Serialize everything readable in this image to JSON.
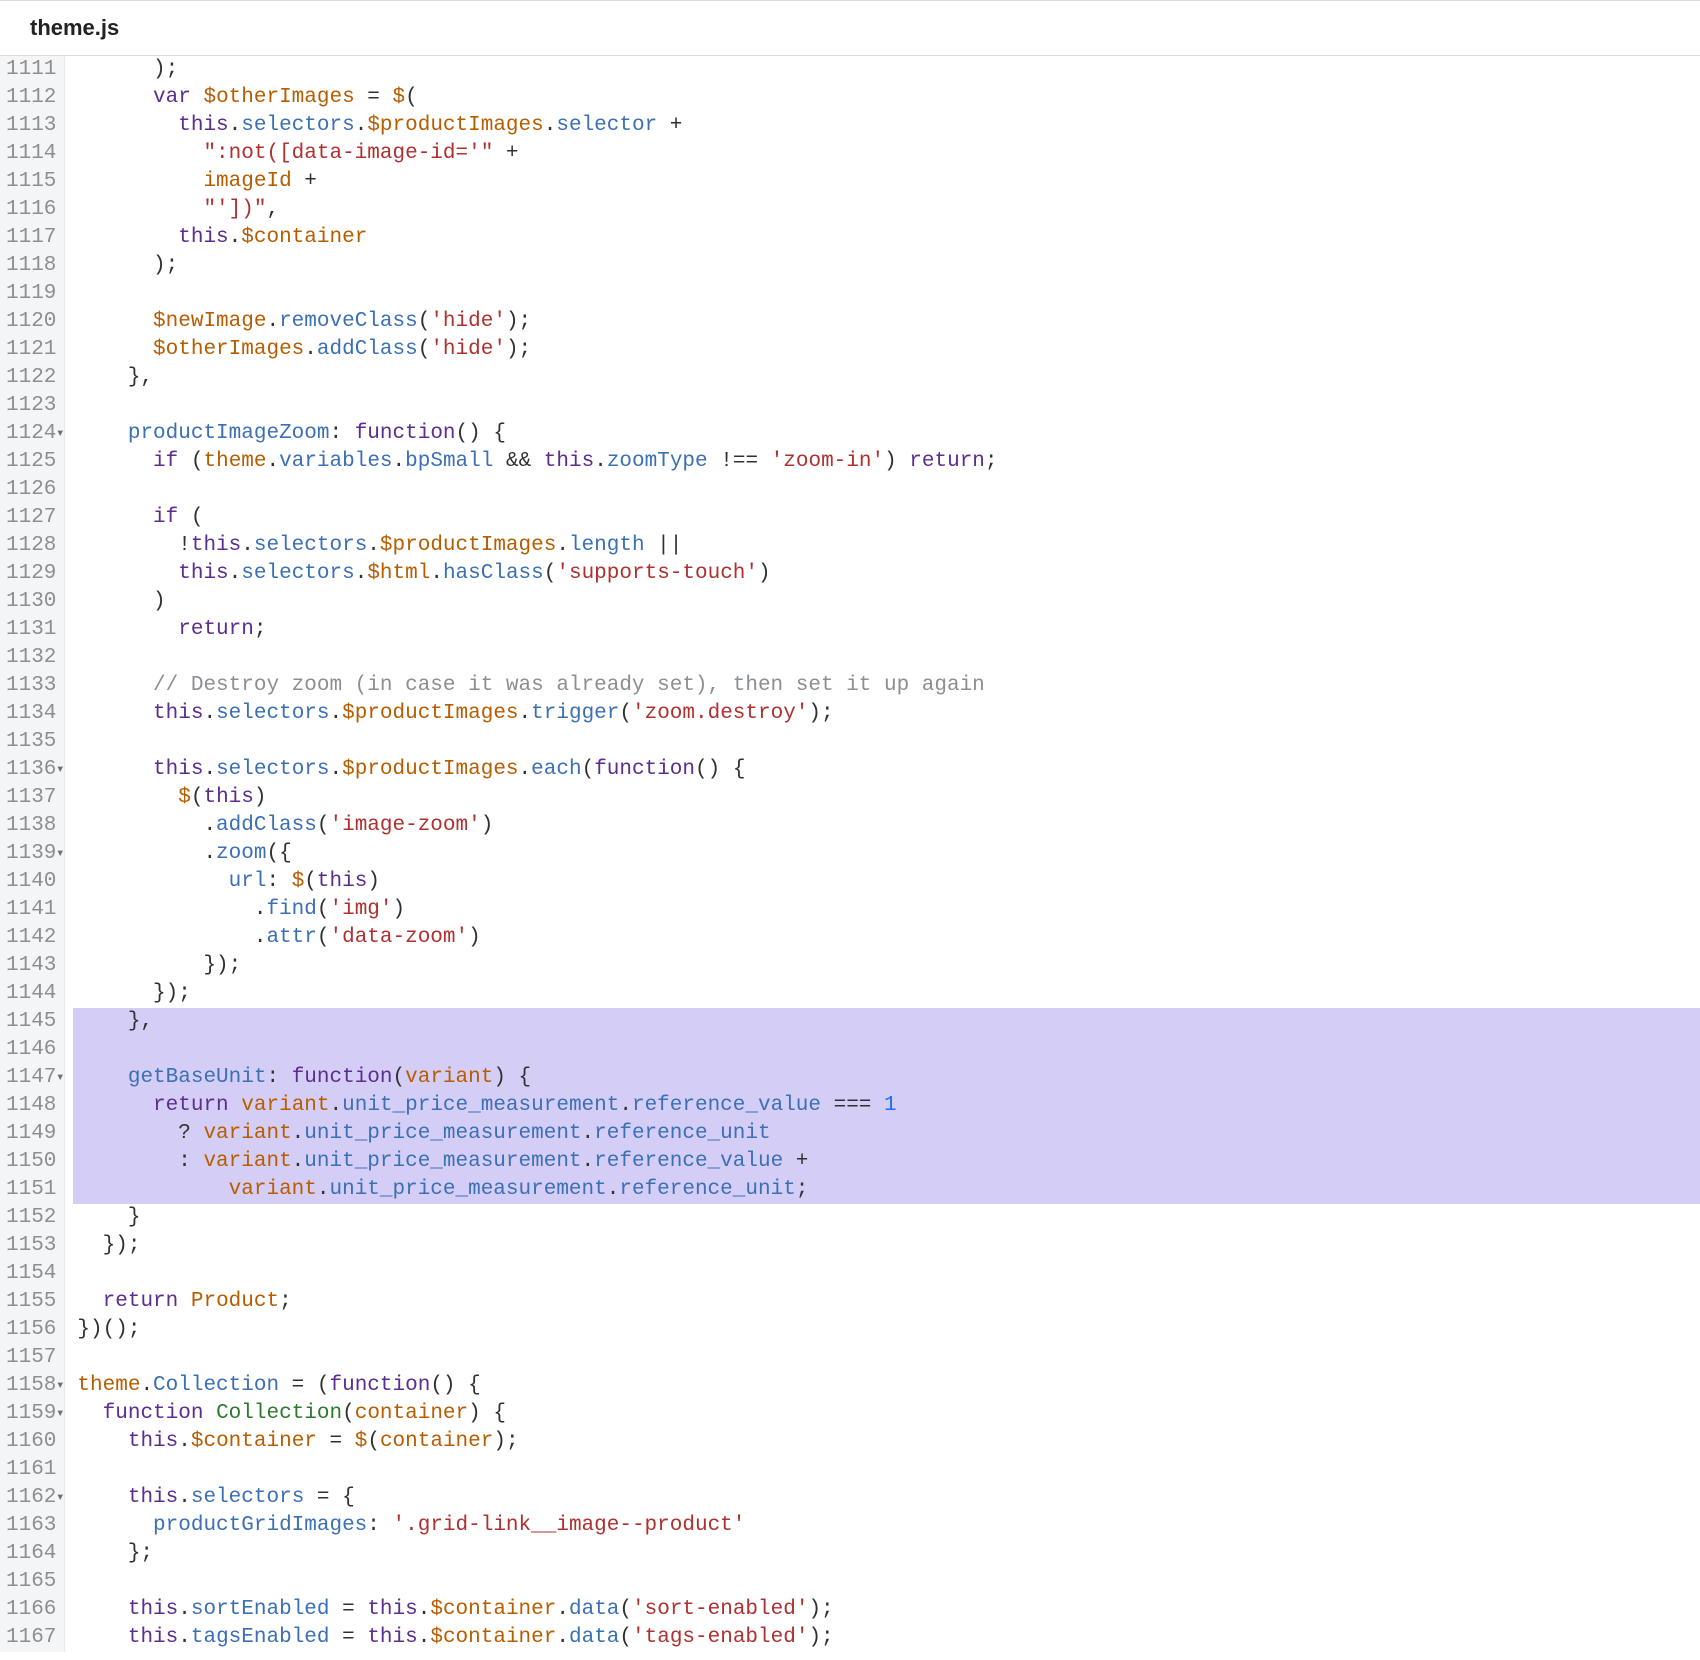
{
  "header": {
    "title": "theme.js"
  },
  "gutter": {
    "start": 1111,
    "end": 1167,
    "folds": [
      1124,
      1136,
      1139,
      1147,
      1158,
      1159,
      1162
    ]
  },
  "highlight": {
    "start": 1145,
    "end": 1151
  },
  "lines": {
    "1111": [
      [
        "punc",
        "      );"
      ]
    ],
    "1112": [
      [
        "punc",
        "      "
      ],
      [
        "kw",
        "var"
      ],
      [
        "punc",
        " "
      ],
      [
        "ident",
        "$otherImages"
      ],
      [
        "punc",
        " = "
      ],
      [
        "ident",
        "$"
      ],
      [
        "punc",
        "("
      ]
    ],
    "1113": [
      [
        "punc",
        "        "
      ],
      [
        "kw",
        "this"
      ],
      [
        "punc",
        "."
      ],
      [
        "prop",
        "selectors"
      ],
      [
        "punc",
        "."
      ],
      [
        "ident",
        "$productImages"
      ],
      [
        "punc",
        "."
      ],
      [
        "prop",
        "selector"
      ],
      [
        "punc",
        " +"
      ]
    ],
    "1114": [
      [
        "punc",
        "          "
      ],
      [
        "str",
        "\":not([data-image-id='\""
      ],
      [
        "punc",
        " +"
      ]
    ],
    "1115": [
      [
        "punc",
        "          "
      ],
      [
        "ident",
        "imageId"
      ],
      [
        "punc",
        " +"
      ]
    ],
    "1116": [
      [
        "punc",
        "          "
      ],
      [
        "str",
        "\"'])\""
      ],
      [
        "punc",
        ","
      ]
    ],
    "1117": [
      [
        "punc",
        "        "
      ],
      [
        "kw",
        "this"
      ],
      [
        "punc",
        "."
      ],
      [
        "ident",
        "$container"
      ]
    ],
    "1118": [
      [
        "punc",
        "      );"
      ]
    ],
    "1119": [
      [
        "punc",
        ""
      ]
    ],
    "1120": [
      [
        "punc",
        "      "
      ],
      [
        "ident",
        "$newImage"
      ],
      [
        "punc",
        "."
      ],
      [
        "prop",
        "removeClass"
      ],
      [
        "punc",
        "("
      ],
      [
        "str",
        "'hide'"
      ],
      [
        "punc",
        ");"
      ]
    ],
    "1121": [
      [
        "punc",
        "      "
      ],
      [
        "ident",
        "$otherImages"
      ],
      [
        "punc",
        "."
      ],
      [
        "prop",
        "addClass"
      ],
      [
        "punc",
        "("
      ],
      [
        "str",
        "'hide'"
      ],
      [
        "punc",
        ");"
      ]
    ],
    "1122": [
      [
        "punc",
        "    },"
      ]
    ],
    "1123": [
      [
        "punc",
        ""
      ]
    ],
    "1124": [
      [
        "punc",
        "    "
      ],
      [
        "prop",
        "productImageZoom"
      ],
      [
        "punc",
        ": "
      ],
      [
        "kw",
        "function"
      ],
      [
        "punc",
        "() {"
      ]
    ],
    "1125": [
      [
        "punc",
        "      "
      ],
      [
        "kw",
        "if"
      ],
      [
        "punc",
        " ("
      ],
      [
        "ident",
        "theme"
      ],
      [
        "punc",
        "."
      ],
      [
        "prop",
        "variables"
      ],
      [
        "punc",
        "."
      ],
      [
        "prop",
        "bpSmall"
      ],
      [
        "punc",
        " && "
      ],
      [
        "kw",
        "this"
      ],
      [
        "punc",
        "."
      ],
      [
        "prop",
        "zoomType"
      ],
      [
        "punc",
        " !== "
      ],
      [
        "str",
        "'zoom-in'"
      ],
      [
        "punc",
        ") "
      ],
      [
        "kw",
        "return"
      ],
      [
        "punc",
        ";"
      ]
    ],
    "1126": [
      [
        "punc",
        ""
      ]
    ],
    "1127": [
      [
        "punc",
        "      "
      ],
      [
        "kw",
        "if"
      ],
      [
        "punc",
        " ("
      ]
    ],
    "1128": [
      [
        "punc",
        "        !"
      ],
      [
        "kw",
        "this"
      ],
      [
        "punc",
        "."
      ],
      [
        "prop",
        "selectors"
      ],
      [
        "punc",
        "."
      ],
      [
        "ident",
        "$productImages"
      ],
      [
        "punc",
        "."
      ],
      [
        "prop",
        "length"
      ],
      [
        "punc",
        " ||"
      ]
    ],
    "1129": [
      [
        "punc",
        "        "
      ],
      [
        "kw",
        "this"
      ],
      [
        "punc",
        "."
      ],
      [
        "prop",
        "selectors"
      ],
      [
        "punc",
        "."
      ],
      [
        "ident",
        "$html"
      ],
      [
        "punc",
        "."
      ],
      [
        "prop",
        "hasClass"
      ],
      [
        "punc",
        "("
      ],
      [
        "str",
        "'supports-touch'"
      ],
      [
        "punc",
        ")"
      ]
    ],
    "1130": [
      [
        "punc",
        "      )"
      ]
    ],
    "1131": [
      [
        "punc",
        "        "
      ],
      [
        "kw",
        "return"
      ],
      [
        "punc",
        ";"
      ]
    ],
    "1132": [
      [
        "punc",
        ""
      ]
    ],
    "1133": [
      [
        "punc",
        "      "
      ],
      [
        "cmt",
        "// Destroy zoom (in case it was already set), then set it up again"
      ]
    ],
    "1134": [
      [
        "punc",
        "      "
      ],
      [
        "kw",
        "this"
      ],
      [
        "punc",
        "."
      ],
      [
        "prop",
        "selectors"
      ],
      [
        "punc",
        "."
      ],
      [
        "ident",
        "$productImages"
      ],
      [
        "punc",
        "."
      ],
      [
        "prop",
        "trigger"
      ],
      [
        "punc",
        "("
      ],
      [
        "str",
        "'zoom.destroy'"
      ],
      [
        "punc",
        ");"
      ]
    ],
    "1135": [
      [
        "punc",
        ""
      ]
    ],
    "1136": [
      [
        "punc",
        "      "
      ],
      [
        "kw",
        "this"
      ],
      [
        "punc",
        "."
      ],
      [
        "prop",
        "selectors"
      ],
      [
        "punc",
        "."
      ],
      [
        "ident",
        "$productImages"
      ],
      [
        "punc",
        "."
      ],
      [
        "prop",
        "each"
      ],
      [
        "punc",
        "("
      ],
      [
        "kw",
        "function"
      ],
      [
        "punc",
        "() {"
      ]
    ],
    "1137": [
      [
        "punc",
        "        "
      ],
      [
        "ident",
        "$"
      ],
      [
        "punc",
        "("
      ],
      [
        "kw",
        "this"
      ],
      [
        "punc",
        ")"
      ]
    ],
    "1138": [
      [
        "punc",
        "          ."
      ],
      [
        "prop",
        "addClass"
      ],
      [
        "punc",
        "("
      ],
      [
        "str",
        "'image-zoom'"
      ],
      [
        "punc",
        ")"
      ]
    ],
    "1139": [
      [
        "punc",
        "          ."
      ],
      [
        "prop",
        "zoom"
      ],
      [
        "punc",
        "({"
      ]
    ],
    "1140": [
      [
        "punc",
        "            "
      ],
      [
        "prop",
        "url"
      ],
      [
        "punc",
        ": "
      ],
      [
        "ident",
        "$"
      ],
      [
        "punc",
        "("
      ],
      [
        "kw",
        "this"
      ],
      [
        "punc",
        ")"
      ]
    ],
    "1141": [
      [
        "punc",
        "              ."
      ],
      [
        "prop",
        "find"
      ],
      [
        "punc",
        "("
      ],
      [
        "str",
        "'img'"
      ],
      [
        "punc",
        ")"
      ]
    ],
    "1142": [
      [
        "punc",
        "              ."
      ],
      [
        "prop",
        "attr"
      ],
      [
        "punc",
        "("
      ],
      [
        "str",
        "'data-zoom'"
      ],
      [
        "punc",
        ")"
      ]
    ],
    "1143": [
      [
        "punc",
        "          });"
      ]
    ],
    "1144": [
      [
        "punc",
        "      });"
      ]
    ],
    "1145": [
      [
        "punc",
        "    },"
      ]
    ],
    "1146": [
      [
        "punc",
        ""
      ]
    ],
    "1147": [
      [
        "punc",
        "    "
      ],
      [
        "prop",
        "getBaseUnit"
      ],
      [
        "punc",
        ": "
      ],
      [
        "kw",
        "function"
      ],
      [
        "punc",
        "("
      ],
      [
        "ident",
        "variant"
      ],
      [
        "punc",
        ") {"
      ]
    ],
    "1148": [
      [
        "punc",
        "      "
      ],
      [
        "kw",
        "return"
      ],
      [
        "punc",
        " "
      ],
      [
        "ident",
        "variant"
      ],
      [
        "punc",
        "."
      ],
      [
        "prop",
        "unit_price_measurement"
      ],
      [
        "punc",
        "."
      ],
      [
        "prop",
        "reference_value"
      ],
      [
        "punc",
        " === "
      ],
      [
        "num",
        "1"
      ]
    ],
    "1149": [
      [
        "punc",
        "        ? "
      ],
      [
        "ident",
        "variant"
      ],
      [
        "punc",
        "."
      ],
      [
        "prop",
        "unit_price_measurement"
      ],
      [
        "punc",
        "."
      ],
      [
        "prop",
        "reference_unit"
      ]
    ],
    "1150": [
      [
        "punc",
        "        : "
      ],
      [
        "ident",
        "variant"
      ],
      [
        "punc",
        "."
      ],
      [
        "prop",
        "unit_price_measurement"
      ],
      [
        "punc",
        "."
      ],
      [
        "prop",
        "reference_value"
      ],
      [
        "punc",
        " +"
      ]
    ],
    "1151": [
      [
        "punc",
        "            "
      ],
      [
        "ident",
        "variant"
      ],
      [
        "punc",
        "."
      ],
      [
        "prop",
        "unit_price_measurement"
      ],
      [
        "punc",
        "."
      ],
      [
        "prop",
        "reference_unit"
      ],
      [
        "punc",
        ";"
      ]
    ],
    "1152": [
      [
        "punc",
        "    }"
      ]
    ],
    "1153": [
      [
        "punc",
        "  });"
      ]
    ],
    "1154": [
      [
        "punc",
        ""
      ]
    ],
    "1155": [
      [
        "punc",
        "  "
      ],
      [
        "kw",
        "return"
      ],
      [
        "punc",
        " "
      ],
      [
        "ident",
        "Product"
      ],
      [
        "punc",
        ";"
      ]
    ],
    "1156": [
      [
        "punc",
        "})();"
      ]
    ],
    "1157": [
      [
        "punc",
        ""
      ]
    ],
    "1158": [
      [
        "ident",
        "theme"
      ],
      [
        "punc",
        "."
      ],
      [
        "prop",
        "Collection"
      ],
      [
        "punc",
        " = ("
      ],
      [
        "kw",
        "function"
      ],
      [
        "punc",
        "() {"
      ]
    ],
    "1159": [
      [
        "punc",
        "  "
      ],
      [
        "kw",
        "function"
      ],
      [
        "punc",
        " "
      ],
      [
        "fn",
        "Collection"
      ],
      [
        "punc",
        "("
      ],
      [
        "ident",
        "container"
      ],
      [
        "punc",
        ") {"
      ]
    ],
    "1160": [
      [
        "punc",
        "    "
      ],
      [
        "kw",
        "this"
      ],
      [
        "punc",
        "."
      ],
      [
        "ident",
        "$container"
      ],
      [
        "punc",
        " = "
      ],
      [
        "ident",
        "$"
      ],
      [
        "punc",
        "("
      ],
      [
        "ident",
        "container"
      ],
      [
        "punc",
        ");"
      ]
    ],
    "1161": [
      [
        "punc",
        ""
      ]
    ],
    "1162": [
      [
        "punc",
        "    "
      ],
      [
        "kw",
        "this"
      ],
      [
        "punc",
        "."
      ],
      [
        "prop",
        "selectors"
      ],
      [
        "punc",
        " = {"
      ]
    ],
    "1163": [
      [
        "punc",
        "      "
      ],
      [
        "prop",
        "productGridImages"
      ],
      [
        "punc",
        ": "
      ],
      [
        "str",
        "'.grid-link__image--product'"
      ]
    ],
    "1164": [
      [
        "punc",
        "    };"
      ]
    ],
    "1165": [
      [
        "punc",
        ""
      ]
    ],
    "1166": [
      [
        "punc",
        "    "
      ],
      [
        "kw",
        "this"
      ],
      [
        "punc",
        "."
      ],
      [
        "prop",
        "sortEnabled"
      ],
      [
        "punc",
        " = "
      ],
      [
        "kw",
        "this"
      ],
      [
        "punc",
        "."
      ],
      [
        "ident",
        "$container"
      ],
      [
        "punc",
        "."
      ],
      [
        "prop",
        "data"
      ],
      [
        "punc",
        "("
      ],
      [
        "str",
        "'sort-enabled'"
      ],
      [
        "punc",
        ");"
      ]
    ],
    "1167": [
      [
        "punc",
        "    "
      ],
      [
        "kw",
        "this"
      ],
      [
        "punc",
        "."
      ],
      [
        "prop",
        "tagsEnabled"
      ],
      [
        "punc",
        " = "
      ],
      [
        "kw",
        "this"
      ],
      [
        "punc",
        "."
      ],
      [
        "ident",
        "$container"
      ],
      [
        "punc",
        "."
      ],
      [
        "prop",
        "data"
      ],
      [
        "punc",
        "("
      ],
      [
        "str",
        "'tags-enabled'"
      ],
      [
        "punc",
        ");"
      ]
    ]
  }
}
